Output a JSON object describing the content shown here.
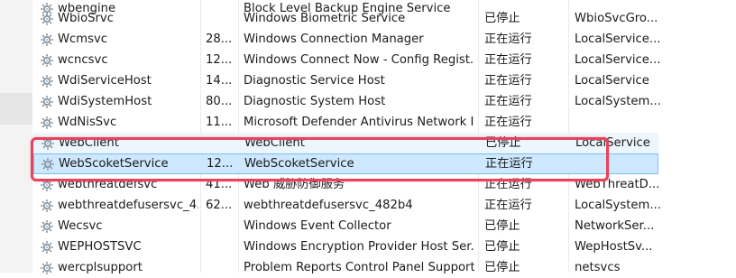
{
  "callout_color": "#e8435a",
  "selection_color": "#cde8ff",
  "rows": [
    {
      "name": "wbengine",
      "pid": "",
      "desc": "Block Level Backup Engine Service",
      "status": "",
      "group": ""
    },
    {
      "name": "WbioSrvc",
      "pid": "",
      "desc": "Windows Biometric Service",
      "status": "已停止",
      "group": "WbioSvcGro..."
    },
    {
      "name": "Wcmsvc",
      "pid": "28...",
      "desc": "Windows Connection Manager",
      "status": "正在运行",
      "group": "LocalService..."
    },
    {
      "name": "wcncsvc",
      "pid": "12...",
      "desc": "Windows Connect Now - Config Regist...",
      "status": "正在运行",
      "group": "LocalService..."
    },
    {
      "name": "WdiServiceHost",
      "pid": "14...",
      "desc": "Diagnostic Service Host",
      "status": "正在运行",
      "group": "LocalService"
    },
    {
      "name": "WdiSystemHost",
      "pid": "80...",
      "desc": "Diagnostic System Host",
      "status": "正在运行",
      "group": "LocalSystem..."
    },
    {
      "name": "WdNisSvc",
      "pid": "11...",
      "desc": "Microsoft Defender Antivirus Network I...",
      "status": "正在运行",
      "group": ""
    },
    {
      "name": "WebClient",
      "pid": "",
      "desc": "WebClient",
      "status": "已停止",
      "group": "LocalService"
    },
    {
      "name": "WebScoketService",
      "pid": "12...",
      "desc": "WebScoketService",
      "status": "正在运行",
      "group": ""
    },
    {
      "name": "webthreatdefsvc",
      "pid": "41...",
      "desc": "Web 威胁防御服务",
      "status": "正在运行",
      "group": "WebThreatD..."
    },
    {
      "name": "webthreatdefusersvc_4...",
      "pid": "62...",
      "desc": "webthreatdefusersvc_482b4",
      "status": "正在运行",
      "group": "LocalSystem..."
    },
    {
      "name": "Wecsvc",
      "pid": "",
      "desc": "Windows Event Collector",
      "status": "已停止",
      "group": "NetworkSer..."
    },
    {
      "name": "WEPHOSTSVC",
      "pid": "",
      "desc": "Windows Encryption Provider Host Ser...",
      "status": "已停止",
      "group": "WepHostSv..."
    },
    {
      "name": "wercplsupport",
      "pid": "",
      "desc": "Problem Reports Control Panel Support",
      "status": "已停止",
      "group": "netsvcs"
    }
  ]
}
